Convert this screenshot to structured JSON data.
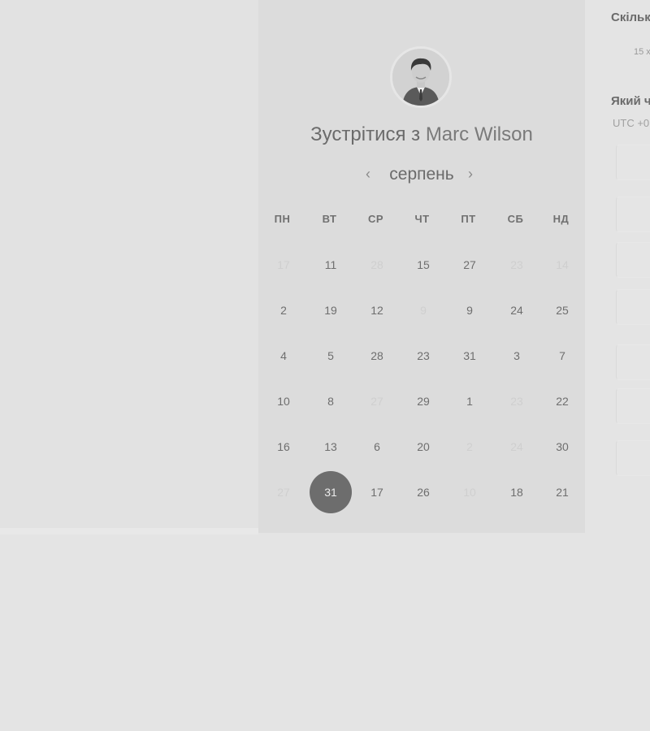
{
  "scheduler": {
    "title_prefix": "Зустрітися з",
    "host_name": "Marc Wilson",
    "month": "серпень",
    "prev_icon": "‹",
    "next_icon": "›"
  },
  "weekdays": [
    "ПН",
    "ВТ",
    "СР",
    "ЧТ",
    "ПТ",
    "СБ",
    "НД"
  ],
  "calendar": {
    "weeks": [
      [
        {
          "d": "17",
          "disabled": true
        },
        {
          "d": "11",
          "disabled": false
        },
        {
          "d": "28",
          "disabled": true
        },
        {
          "d": "15",
          "disabled": false
        },
        {
          "d": "27",
          "disabled": false
        },
        {
          "d": "23",
          "disabled": true
        },
        {
          "d": "14",
          "disabled": true
        }
      ],
      [
        {
          "d": "2",
          "disabled": false
        },
        {
          "d": "19",
          "disabled": false
        },
        {
          "d": "12",
          "disabled": false
        },
        {
          "d": "9",
          "disabled": true
        },
        {
          "d": "9",
          "disabled": false
        },
        {
          "d": "24",
          "disabled": false
        },
        {
          "d": "25",
          "disabled": false
        }
      ],
      [
        {
          "d": "4",
          "disabled": false
        },
        {
          "d": "5",
          "disabled": false
        },
        {
          "d": "28",
          "disabled": false
        },
        {
          "d": "23",
          "disabled": false
        },
        {
          "d": "31",
          "disabled": false
        },
        {
          "d": "3",
          "disabled": false
        },
        {
          "d": "7",
          "disabled": false
        }
      ],
      [
        {
          "d": "10",
          "disabled": false
        },
        {
          "d": "8",
          "disabled": false
        },
        {
          "d": "27",
          "disabled": true
        },
        {
          "d": "29",
          "disabled": false
        },
        {
          "d": "1",
          "disabled": false
        },
        {
          "d": "23",
          "disabled": true
        },
        {
          "d": "22",
          "disabled": false
        }
      ],
      [
        {
          "d": "16",
          "disabled": false
        },
        {
          "d": "13",
          "disabled": false
        },
        {
          "d": "6",
          "disabled": false
        },
        {
          "d": "20",
          "disabled": false
        },
        {
          "d": "2",
          "disabled": true
        },
        {
          "d": "24",
          "disabled": true
        },
        {
          "d": "30",
          "disabled": false
        }
      ],
      [
        {
          "d": "27",
          "disabled": true
        },
        {
          "d": "31",
          "disabled": false,
          "selected": true
        },
        {
          "d": "17",
          "disabled": false
        },
        {
          "d": "26",
          "disabled": false
        },
        {
          "d": "10",
          "disabled": true
        },
        {
          "d": "18",
          "disabled": false
        },
        {
          "d": "21",
          "disabled": false
        }
      ]
    ]
  },
  "right_panel": {
    "duration_title": "Скільк",
    "duration_value": "15 х",
    "time_title": "Який ч",
    "timezone": "UTC +0"
  },
  "colors": {
    "selected_day": "#6d6d6d",
    "calendar_bg": "#dcdcdc",
    "page_bg": "#e4e4e4"
  }
}
